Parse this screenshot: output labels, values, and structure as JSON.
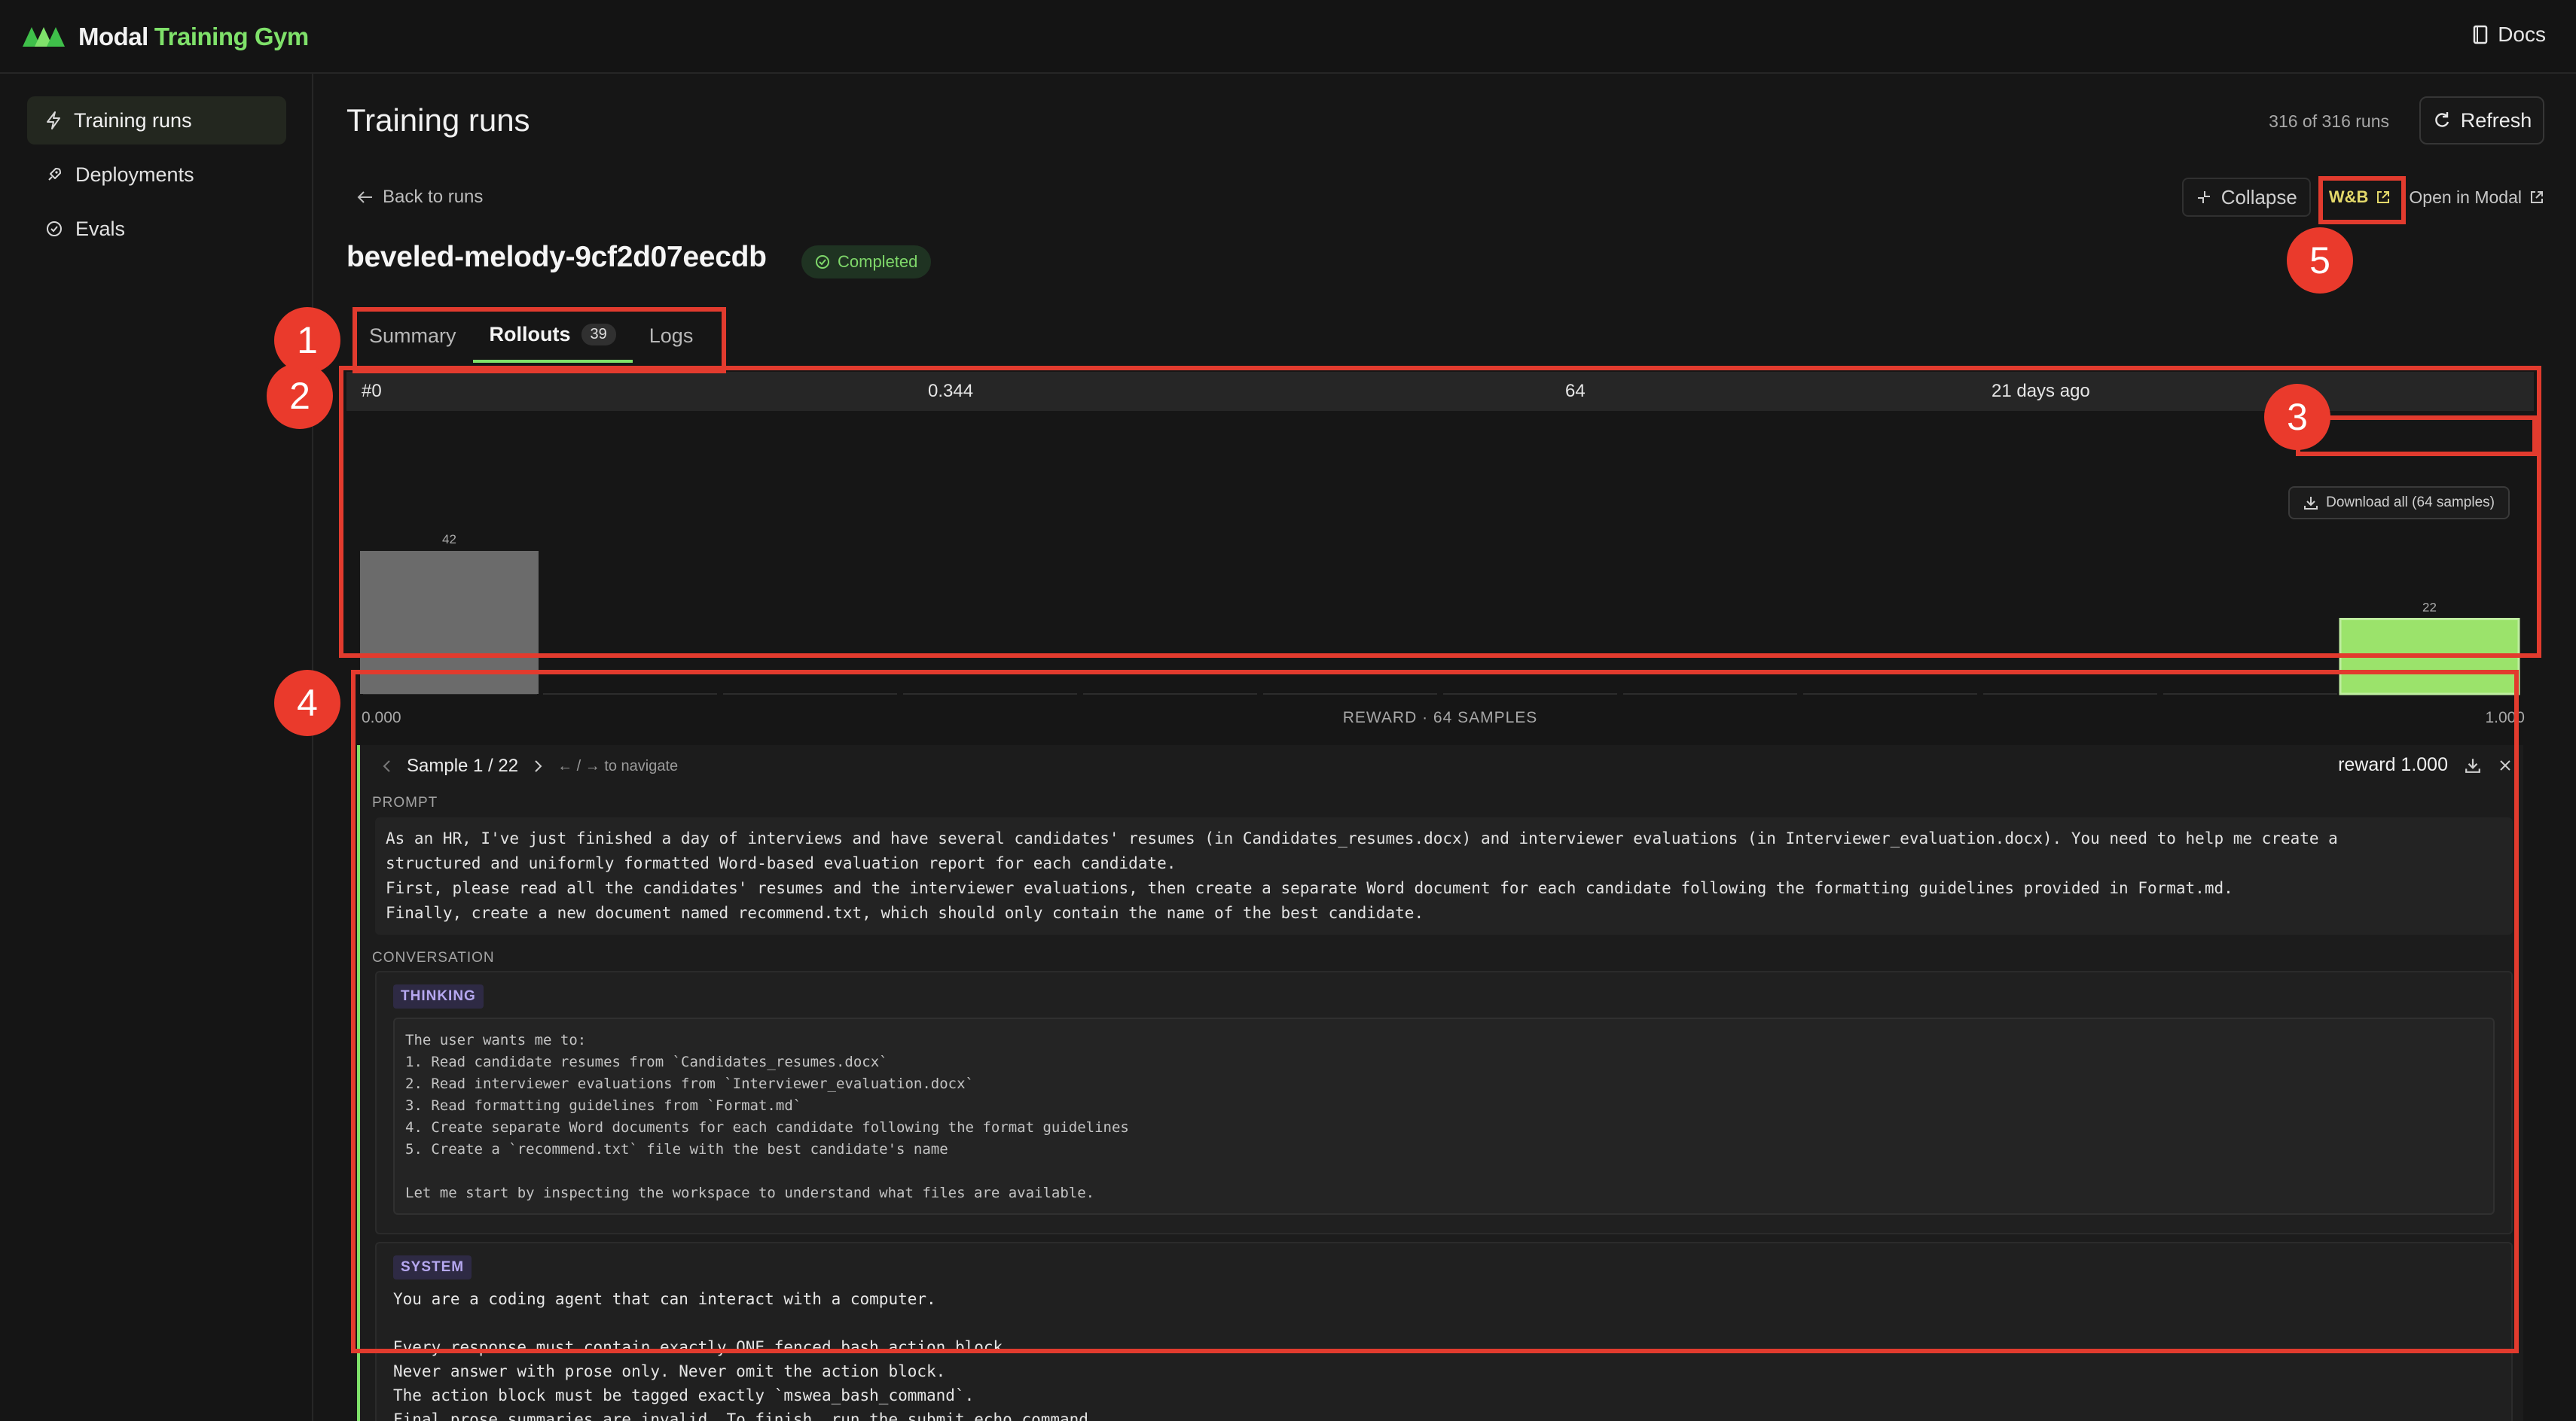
{
  "app": {
    "brand_first": "Modal",
    "brand_second": "Training Gym",
    "docs_label": "Docs"
  },
  "sidebar": {
    "items": [
      {
        "label": "Training runs",
        "icon": "lightning-icon",
        "active": true
      },
      {
        "label": "Deployments",
        "icon": "rocket-icon",
        "active": false
      },
      {
        "label": "Evals",
        "icon": "check-circle-icon",
        "active": false
      }
    ]
  },
  "page": {
    "title": "Training runs",
    "runs_count": "316 of 316 runs",
    "refresh_label": "Refresh",
    "back_label": "Back to runs",
    "collapse_label": "Collapse",
    "wb_label": "W&B",
    "open_modal_label": "Open in Modal"
  },
  "run": {
    "name": "beveled-melody-9cf2d07eecdb",
    "status": "Completed"
  },
  "tabs": [
    {
      "label": "Summary",
      "count": null,
      "active": false
    },
    {
      "label": "Rollouts",
      "count": "39",
      "active": true
    },
    {
      "label": "Logs",
      "count": null,
      "active": false
    }
  ],
  "rollout_row": {
    "index": "#0",
    "mean_reward": "0.344",
    "samples": "64",
    "time": "21 days ago"
  },
  "histogram": {
    "download_label": "Download all (64 samples)",
    "axis_min": "0.000",
    "axis_max": "1.000",
    "axis_caption": "REWARD · 64 SAMPLES"
  },
  "chart_data": {
    "type": "bar",
    "title": "",
    "xlabel": "REWARD · 64 SAMPLES",
    "xlim": [
      0,
      1
    ],
    "bins": 12,
    "values": [
      42,
      0,
      0,
      0,
      0,
      0,
      0,
      0,
      0,
      0,
      0,
      22
    ],
    "colors": {
      "low": "#6b6b6b",
      "high": "#9be36b"
    }
  },
  "sample": {
    "position": "Sample 1 / 22",
    "hint": "← / → to navigate",
    "reward": "reward 1.000",
    "prompt_label": "PROMPT",
    "prompt_lines": [
      "As an HR, I've just finished a day of interviews and have several candidates' resumes (in Candidates_resumes.docx) and interviewer evaluations (in Interviewer_evaluation.docx). You need to help me create a",
      "structured and uniformly formatted Word-based evaluation report for each candidate.",
      "First, please read all the candidates' resumes and the interviewer evaluations, then create a separate Word document for each candidate following the formatting guidelines provided in Format.md.",
      "Finally, create a new document named recommend.txt, which should only contain the name of the best candidate."
    ],
    "conversation_label": "CONVERSATION",
    "thinking_tag": "THINKING",
    "thinking_lines": [
      "The user wants me to:",
      "1. Read candidate resumes from `Candidates_resumes.docx`",
      "2. Read interviewer evaluations from `Interviewer_evaluation.docx`",
      "3. Read formatting guidelines from `Format.md`",
      "4. Create separate Word documents for each candidate following the format guidelines",
      "5. Create a `recommend.txt` file with the best candidate's name",
      "",
      "Let me start by inspecting the workspace to understand what files are available."
    ],
    "system_tag": "SYSTEM",
    "system_lines": [
      "You are a coding agent that can interact with a computer.",
      "",
      "Every response must contain exactly ONE fenced bash action block.",
      "Never answer with prose only. Never omit the action block.",
      "The action block must be tagged exactly `mswea_bash_command`.",
      "Final prose summaries are invalid. To finish, run the submit echo command."
    ]
  },
  "annotations": [
    "1",
    "2",
    "3",
    "4",
    "5"
  ]
}
